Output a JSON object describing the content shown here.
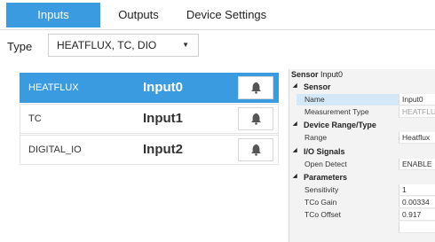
{
  "tabs": [
    {
      "label": "Inputs",
      "active": true
    },
    {
      "label": "Outputs",
      "active": false
    },
    {
      "label": "Device Settings",
      "active": false
    }
  ],
  "type_filter": {
    "label": "Type",
    "value": "HEATFLUX, TC, DIO"
  },
  "inputs": [
    {
      "type": "HEATFLUX",
      "name": "Input0",
      "selected": true,
      "icon": "bell-icon"
    },
    {
      "type": "TC",
      "name": "Input1",
      "selected": false,
      "icon": "bell-icon"
    },
    {
      "type": "DIGITAL_IO",
      "name": "Input2",
      "selected": false,
      "icon": "bell-icon"
    }
  ],
  "properties": {
    "header_label": "Sensor",
    "header_value": "Input0",
    "categories": [
      {
        "name": "Sensor",
        "rows": [
          {
            "name": "Name",
            "value": "Input0"
          },
          {
            "name": "Measurement Type",
            "value": "HEATFLU"
          }
        ]
      },
      {
        "name": "Device Range/Type",
        "rows": [
          {
            "name": "Range",
            "value": "Heatflux"
          }
        ]
      },
      {
        "name": "I/O Signals",
        "rows": [
          {
            "name": "Open Detect",
            "value": "ENABLE"
          }
        ]
      },
      {
        "name": "Parameters",
        "rows": [
          {
            "name": "Sensitivity",
            "value": "1"
          },
          {
            "name": "TCo Gain",
            "value": "0.00334"
          },
          {
            "name": "TCo Offset",
            "value": "0.917"
          },
          {
            "name": "",
            "value": ""
          }
        ]
      }
    ]
  },
  "colors": {
    "accent": "#3b9be0",
    "selected_property": "#d5e8f8",
    "grid_background": "#f3f3f3"
  }
}
